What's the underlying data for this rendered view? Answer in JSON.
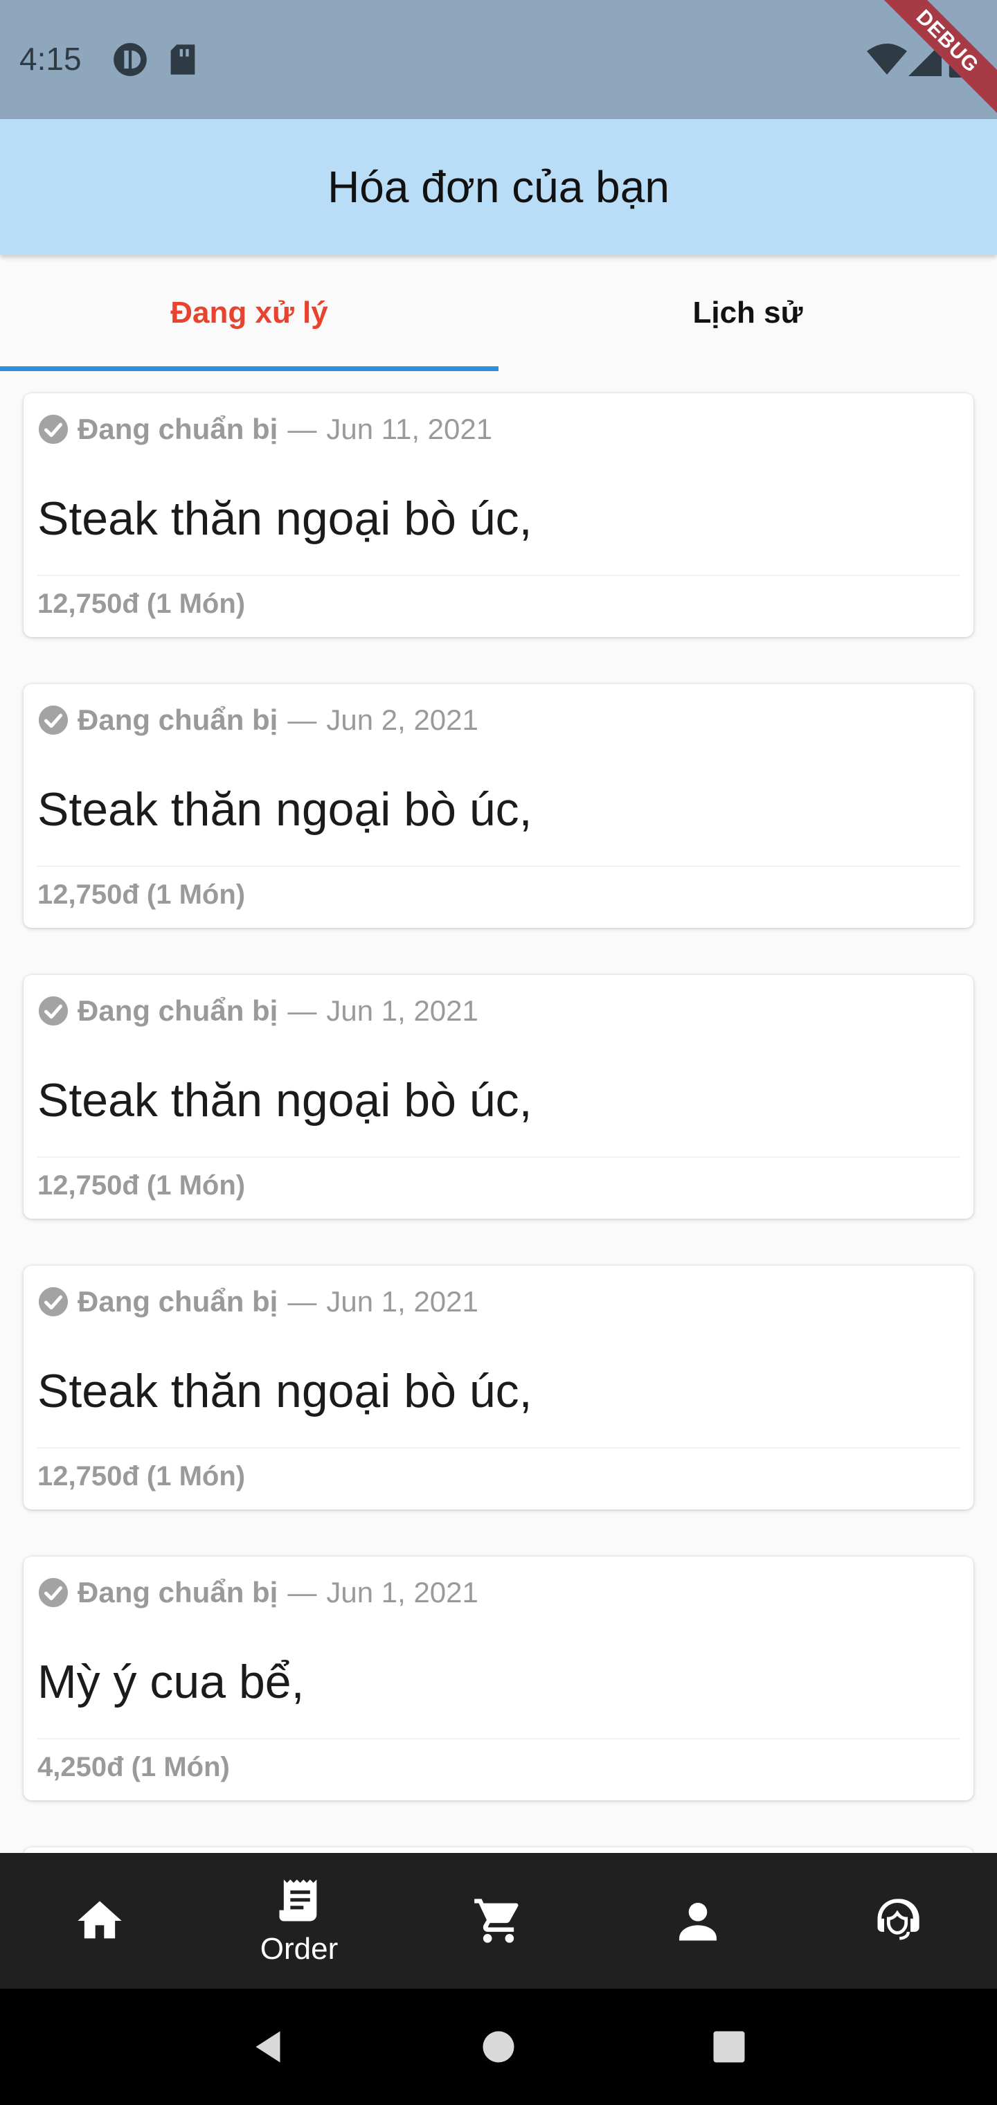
{
  "status_bar": {
    "time": "4:15",
    "debug_label": "DEBUG",
    "icons": [
      "app-icon",
      "sd-card-icon",
      "wifi-icon",
      "signal-icon",
      "battery-icon"
    ]
  },
  "app_bar": {
    "title": "Hóa đơn của bạn"
  },
  "tabs": [
    {
      "label": "Đang xử lý",
      "active": true
    },
    {
      "label": "Lịch sử",
      "active": false
    }
  ],
  "orders": [
    {
      "status": "Đang chuẩn bị",
      "separator": "—",
      "date": "Jun 11, 2021",
      "item": "Steak thăn ngoại bò úc,",
      "price": "12,750đ (1 Món)"
    },
    {
      "status": "Đang chuẩn bị",
      "separator": "—",
      "date": "Jun 2, 2021",
      "item": "Steak thăn ngoại bò úc,",
      "price": "12,750đ (1 Món)"
    },
    {
      "status": "Đang chuẩn bị",
      "separator": "—",
      "date": "Jun 1, 2021",
      "item": "Steak thăn ngoại bò úc,",
      "price": "12,750đ (1 Món)"
    },
    {
      "status": "Đang chuẩn bị",
      "separator": "—",
      "date": "Jun 1, 2021",
      "item": "Steak thăn ngoại bò úc,",
      "price": "12,750đ (1 Món)"
    },
    {
      "status": "Đang chuẩn bị",
      "separator": "—",
      "date": "Jun 1, 2021",
      "item": "Mỳ ý cua bể,",
      "price": "4,250đ (1 Món)"
    }
  ],
  "bottom_nav": {
    "items": [
      {
        "icon": "home-icon",
        "label": ""
      },
      {
        "icon": "order-icon",
        "label": "Order"
      },
      {
        "icon": "cart-icon",
        "label": ""
      },
      {
        "icon": "person-icon",
        "label": ""
      },
      {
        "icon": "support-icon",
        "label": ""
      }
    ]
  },
  "colors": {
    "status_bar": "#8fa7bd",
    "app_bar": "#b9dcf7",
    "active_tab": "#e8432f",
    "tab_indicator": "#2e8fe0",
    "bottom_nav": "#202020"
  }
}
